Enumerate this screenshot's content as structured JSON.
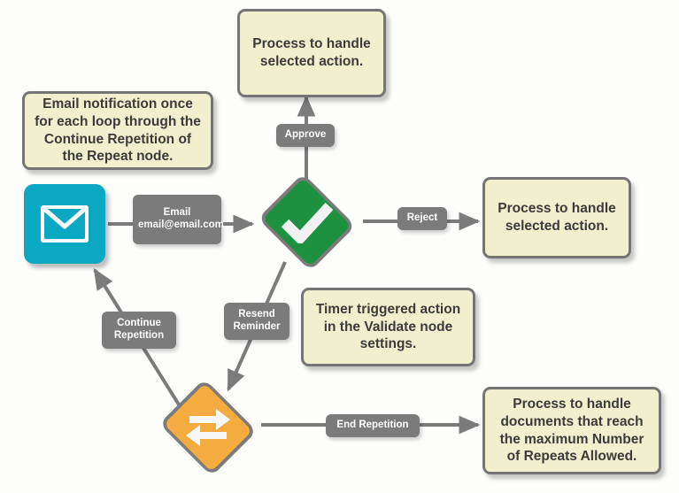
{
  "diagram": {
    "title": "Email approval workflow with repeat loop",
    "background_color": "#fdfdfc",
    "callout_fill": "#f2efce",
    "callout_border": "#757575",
    "chip_fill": "#7b7b7b",
    "edge_color": "#7b7b7b",
    "email_node_color": "#0aa8c2",
    "validate_node_color": "#1e9141",
    "repeat_node_color": "#f4ab3f"
  },
  "nodes": {
    "email": {
      "name": "Email",
      "icon": "envelope-icon"
    },
    "validate": {
      "name": "Validate",
      "icon": "check-mark-icon"
    },
    "repeat": {
      "name": "Repeat",
      "icon": "repeat-loop-icon"
    }
  },
  "callouts": [
    {
      "id": "approve-note",
      "text": "Process to handle selected action."
    },
    {
      "id": "email-note",
      "text": "Email notification once for each loop through the Continue Repetition of the Repeat node."
    },
    {
      "id": "reject-note",
      "text": "Process to handle selected action."
    },
    {
      "id": "timer-note",
      "text": "Timer triggered action in the Validate node settings."
    },
    {
      "id": "end-repetition-note",
      "text": "Process to handle documents that reach the maximum Number of Repeats Allowed."
    }
  ],
  "edge_labels": {
    "email": "Email email@email.com",
    "approve": "Approve",
    "reject": "Reject",
    "resend_reminder": "Resend Reminder",
    "continue_repetition": "Continue Repetition",
    "end_repetition": "End Repetition"
  }
}
